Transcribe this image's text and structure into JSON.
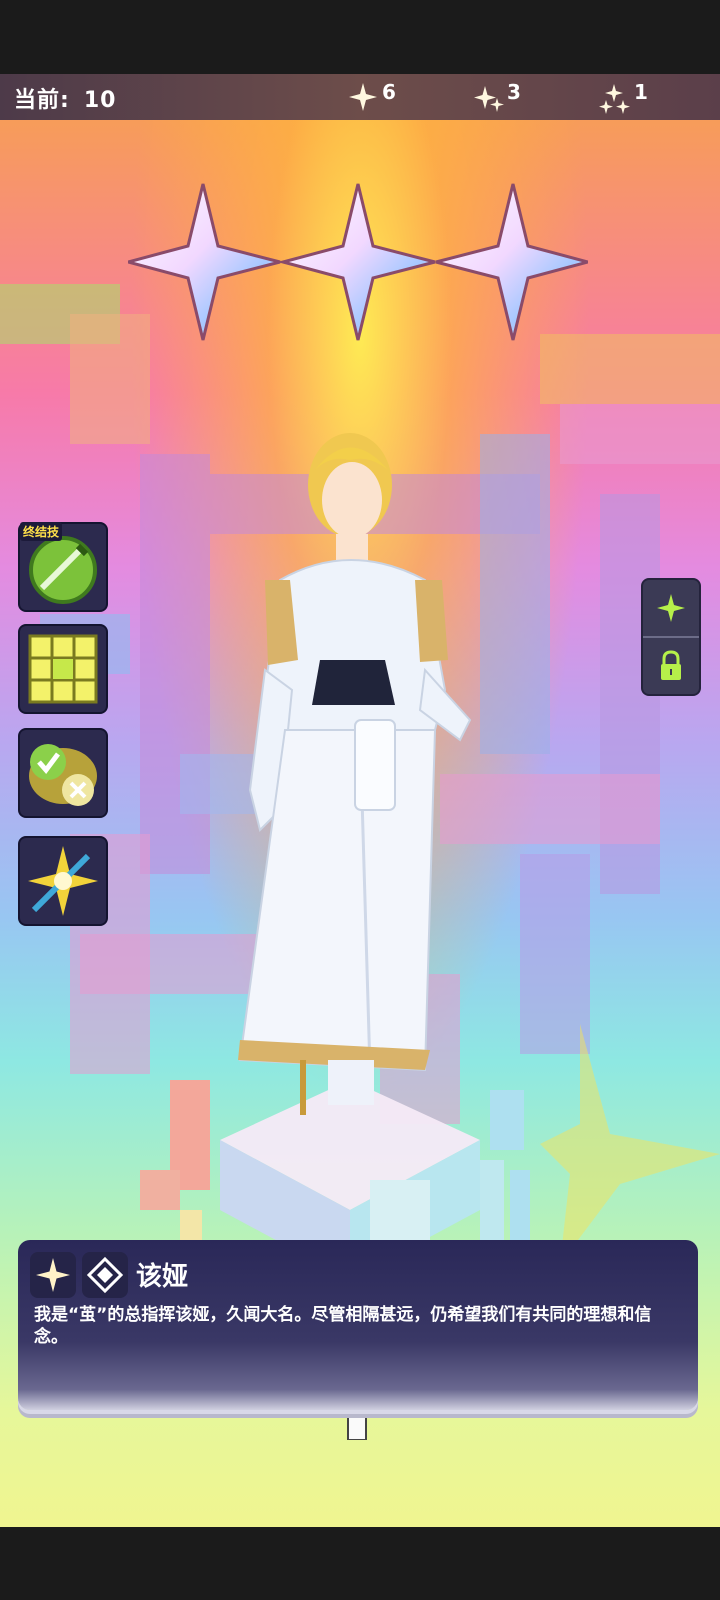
{
  "status": {
    "current_label": "当前:",
    "current_value": "10",
    "counts": [
      {
        "icon": "one-sparkle-icon",
        "value": "6"
      },
      {
        "icon": "two-sparkle-icon",
        "value": "3"
      },
      {
        "icon": "three-sparkle-icon",
        "value": "1"
      }
    ]
  },
  "rarity_stars": 3,
  "skills": [
    {
      "icon": "ultimate-blade-icon",
      "badge": "终结技"
    },
    {
      "icon": "grid-tiles-icon"
    },
    {
      "icon": "check-cross-icon"
    },
    {
      "icon": "lightning-strike-icon"
    }
  ],
  "side_panel": {
    "items": [
      {
        "icon": "sparkle-icon"
      },
      {
        "icon": "lock-icon"
      }
    ]
  },
  "dialog": {
    "name": "该娅",
    "text": "我是“茧”的总指挥该娅，久闻大名。尽管相隔甚远，仍希望我们有共同的理想和信念。",
    "icons": [
      "sparkle-icon",
      "faction-emblem-icon"
    ]
  },
  "colors": {
    "panel": "#2a2858",
    "accent": "#b6f04a",
    "badge_text": "#ffe04a"
  }
}
